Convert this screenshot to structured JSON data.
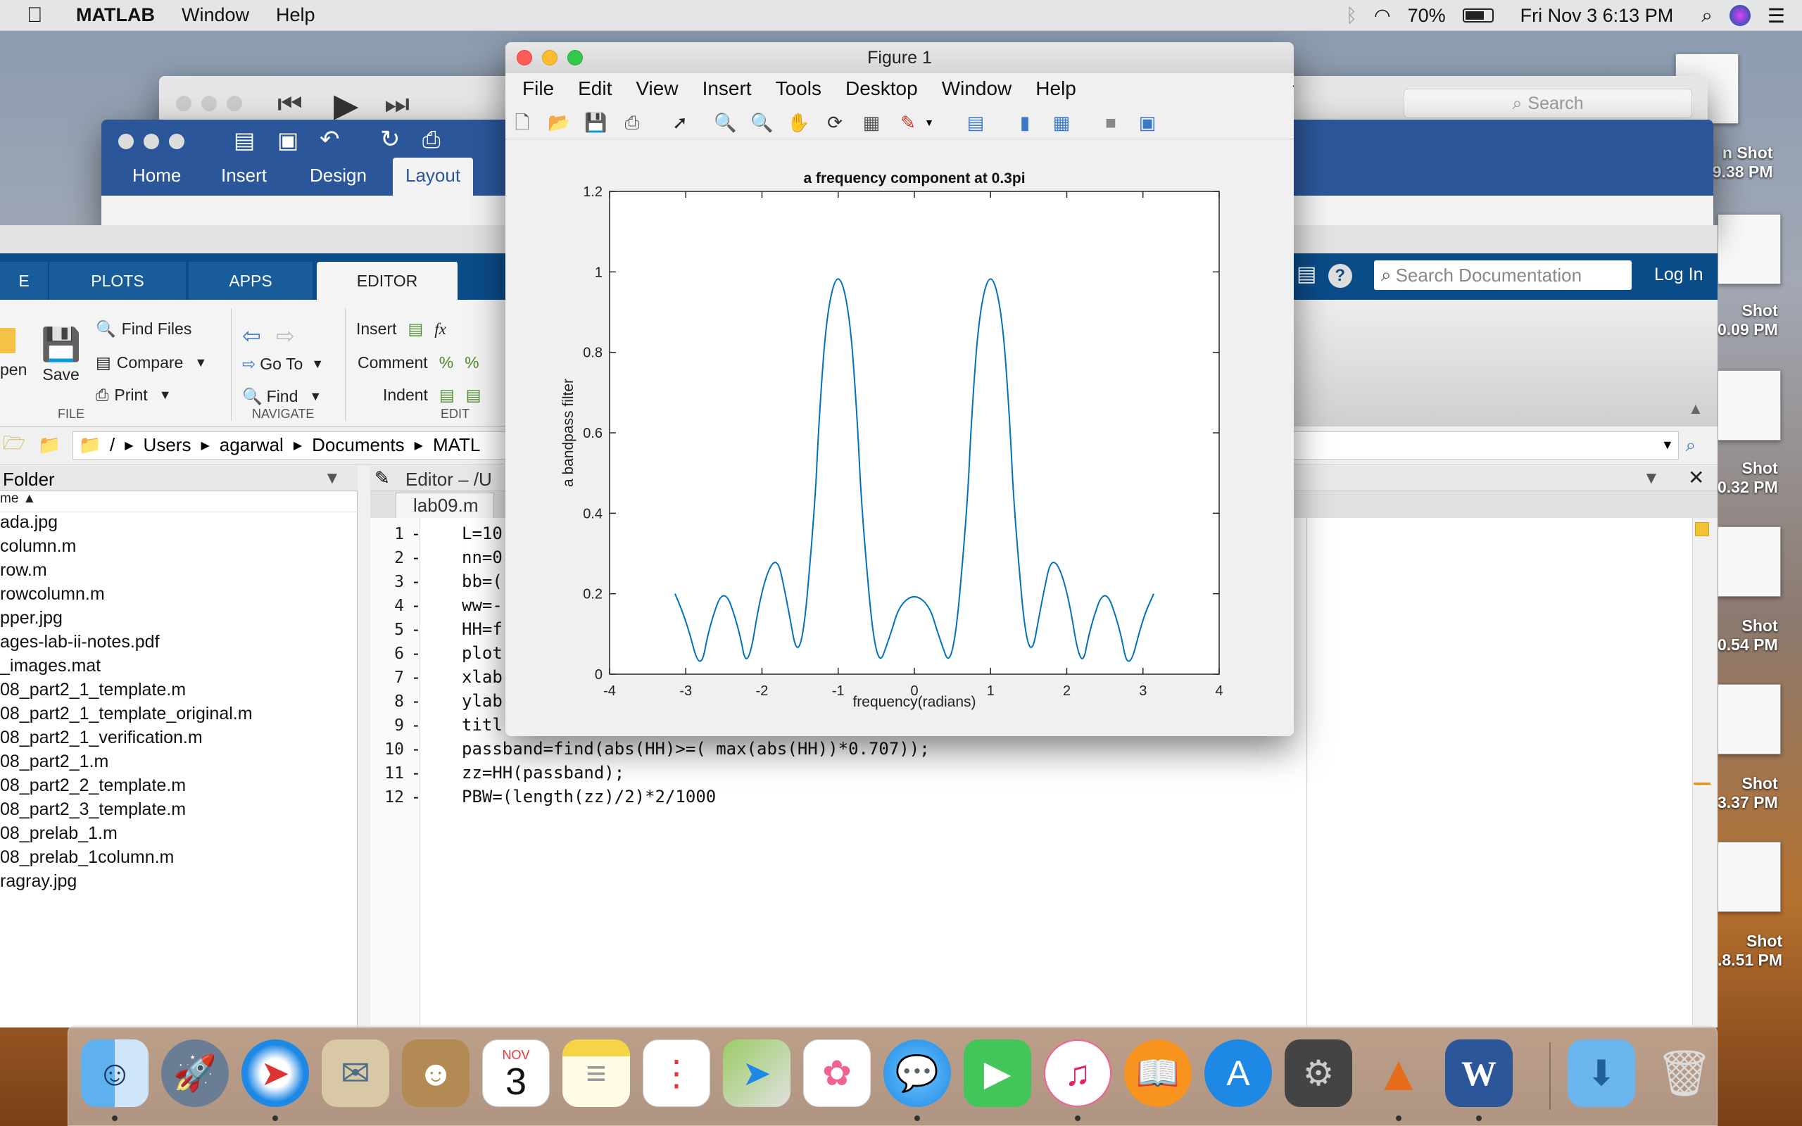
{
  "menubar": {
    "app": "MATLAB",
    "items": [
      "Window",
      "Help"
    ],
    "battery": "70%",
    "datetime": "Fri Nov 3  6:13 PM"
  },
  "word_window": {
    "tabs": [
      "Home",
      "Insert",
      "Design",
      "Layout"
    ]
  },
  "doc_window": {
    "search_placeholder": "Search"
  },
  "matlab": {
    "tabs": [
      "PLOTS",
      "APPS",
      "EDITOR"
    ],
    "file_group": {
      "open": "pen",
      "save": "Save",
      "find_files": "Find Files",
      "compare": "Compare",
      "print": "Print",
      "label": "FILE"
    },
    "navigate_group": {
      "goto": "Go To",
      "find": "Find",
      "label": "NAVIGATE"
    },
    "edit_group": {
      "insert": "Insert",
      "comment": "Comment",
      "indent": "Indent",
      "label": "EDIT"
    },
    "search_docs_placeholder": "Search Documentation",
    "login": "Log In",
    "path": [
      "/",
      "Users",
      "agarwal",
      "Documents",
      "MATL"
    ],
    "current_folder_title": "Folder",
    "column_header": "me",
    "files": [
      "ada.jpg",
      "column.m",
      "row.m",
      "rowcolumn.m",
      "pper.jpg",
      "ages-lab-ii-notes.pdf",
      "_images.mat",
      "08_part2_1_template.m",
      "08_part2_1_template_original.m",
      "08_part2_1_verification.m",
      "08_part2_1.m",
      "08_part2_2_template.m",
      "08_part2_3_template.m",
      "08_prelab_1.m",
      "08_prelab_1column.m",
      "ragray.jpg"
    ],
    "editor_title": "Editor – /U",
    "editor_tab": "lab09.m",
    "code_lines": [
      {
        "n": "1",
        "text": "L=10"
      },
      {
        "n": "2",
        "text": "nn=0"
      },
      {
        "n": "3",
        "text": "bb=("
      },
      {
        "n": "4",
        "text": "ww=-"
      },
      {
        "n": "5",
        "text": "HH=f"
      },
      {
        "n": "6",
        "text": "plot"
      },
      {
        "n": "7",
        "text": "xlab"
      },
      {
        "n": "8",
        "text": "ylab"
      },
      {
        "n": "9",
        "text": "titl"
      },
      {
        "n": "10",
        "text": "passband=find(abs(HH)>=( max(abs(HH))*0.707));"
      },
      {
        "n": "11",
        "text": "zz=HH(passband);"
      },
      {
        "n": "12",
        "text": "PBW=(length(zz)/2)*2/1000"
      }
    ]
  },
  "figure": {
    "window_title": "Figure 1",
    "menu": [
      "File",
      "Edit",
      "View",
      "Insert",
      "Tools",
      "Desktop",
      "Window",
      "Help"
    ]
  },
  "chart_data": {
    "type": "line",
    "title": "a frequency component at 0.3pi",
    "xlabel": "frequency(radians)",
    "ylabel": "a bandpass filter",
    "xlim": [
      -4,
      4
    ],
    "ylim": [
      0,
      1.2
    ],
    "xticks": [
      "-4",
      "-3",
      "-2",
      "-1",
      "0",
      "1",
      "2",
      "3",
      "4"
    ],
    "yticks": [
      "0",
      "0.2",
      "0.4",
      "0.6",
      "0.8",
      "1",
      "1.2"
    ],
    "series": [
      {
        "color": "#0072bd",
        "x": [
          -3.1416,
          -3.0,
          -2.81,
          -2.69,
          -2.5,
          -2.31,
          -2.19,
          -2.0,
          -1.81,
          -1.69,
          -1.5,
          -1.31,
          -1.25,
          -1.15,
          -1.0,
          -0.85,
          -0.75,
          -0.69,
          -0.5,
          -0.31,
          -0.2,
          0.0,
          0.2,
          0.31,
          0.5,
          0.69,
          0.75,
          0.85,
          1.0,
          1.15,
          1.25,
          1.31,
          1.5,
          1.69,
          1.81,
          2.0,
          2.19,
          2.31,
          2.5,
          2.69,
          2.81,
          3.0,
          3.1416
        ],
        "y": [
          0.2,
          0.14,
          0.0,
          0.12,
          0.22,
          0.12,
          0.0,
          0.22,
          0.3,
          0.2,
          0.0,
          0.4,
          0.64,
          0.9,
          1.01,
          0.9,
          0.64,
          0.4,
          0.0,
          0.1,
          0.17,
          0.2,
          0.17,
          0.1,
          0.0,
          0.4,
          0.64,
          0.9,
          1.01,
          0.9,
          0.64,
          0.4,
          0.0,
          0.2,
          0.3,
          0.22,
          0.0,
          0.12,
          0.22,
          0.12,
          0.0,
          0.14,
          0.2
        ]
      }
    ]
  },
  "desktop_labels": [
    "n Shot",
    "..9.38 PM",
    "Shot",
    "0.09 PM",
    "Shot",
    "0.32 PM",
    "Shot",
    "0.54 PM",
    "Shot",
    "3.37 PM",
    "Shot",
    ".8.51 PM"
  ],
  "dock_apps": [
    "finder-icon",
    "launchpad-icon",
    "safari-icon",
    "mail-icon",
    "contacts-icon",
    "calendar-icon",
    "notes-icon",
    "reminders-icon",
    "maps-icon",
    "photos-icon",
    "messages-icon",
    "facetime-icon",
    "itunes-icon",
    "ibooks-icon",
    "app-store-icon",
    "system-preferences-icon",
    "matlab-icon",
    "word-icon",
    "downloads-icon",
    "trash-icon"
  ],
  "calendar": {
    "month": "NOV",
    "day": "3"
  }
}
